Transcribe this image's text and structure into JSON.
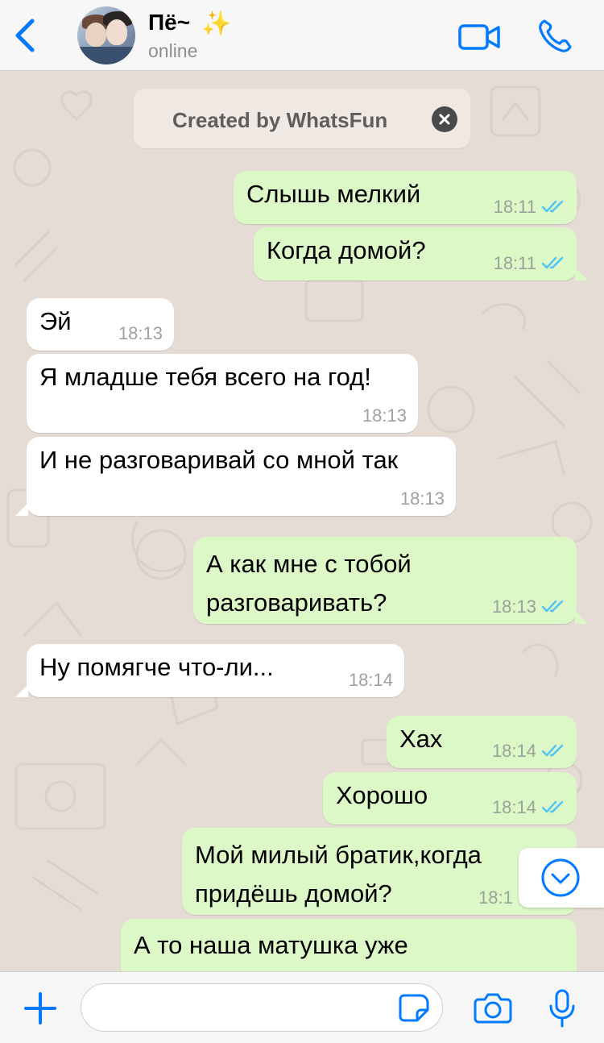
{
  "header": {
    "contact_name": "Пё~",
    "sparkle_emoji": "✨",
    "status": "online",
    "icons": {
      "back": "chevron-left-icon",
      "video": "video-camera-icon",
      "call": "phone-icon"
    },
    "accent_color": "#007aff"
  },
  "notice": {
    "text": "Created by WhatsFun",
    "close_icon": "close-icon"
  },
  "messages": [
    {
      "dir": "out",
      "text": "Слышь мелкий",
      "time": "18:11",
      "read": true
    },
    {
      "dir": "out",
      "text": "Когда домой?",
      "time": "18:11",
      "read": true
    },
    {
      "dir": "in",
      "text": "Эй",
      "time": "18:13"
    },
    {
      "dir": "in",
      "text": "Я младше тебя всего на год!",
      "time": "18:13"
    },
    {
      "dir": "in",
      "text": "И не разговаривай со мной так",
      "time": "18:13"
    },
    {
      "dir": "out",
      "line1": "А как мне с тобой",
      "line2": "разговаривать?",
      "time": "18:13",
      "read": true
    },
    {
      "dir": "in",
      "text": "Ну помягче что-ли...",
      "time": "18:14"
    },
    {
      "dir": "out",
      "text": "Хах",
      "time": "18:14",
      "read": true
    },
    {
      "dir": "out",
      "text": "Хорошо",
      "time": "18:14",
      "read": true
    },
    {
      "dir": "out",
      "line1": "Мой милый братик,когда",
      "line2": "придёшь домой?",
      "time": "18:1",
      "read": true
    },
    {
      "dir": "out",
      "text": "А то наша матушка уже"
    }
  ],
  "colors": {
    "outgoing_bubble": "#dcf8c6",
    "incoming_bubble": "#ffffff",
    "read_ticks": "#4fc3f7",
    "wallpaper": "#e5ddd5"
  },
  "input_bar": {
    "placeholder": "",
    "value": "",
    "icons": [
      "plus-icon",
      "sticker-icon",
      "camera-icon",
      "microphone-icon"
    ]
  },
  "scroll_button": {
    "icon": "chevron-down-icon"
  }
}
